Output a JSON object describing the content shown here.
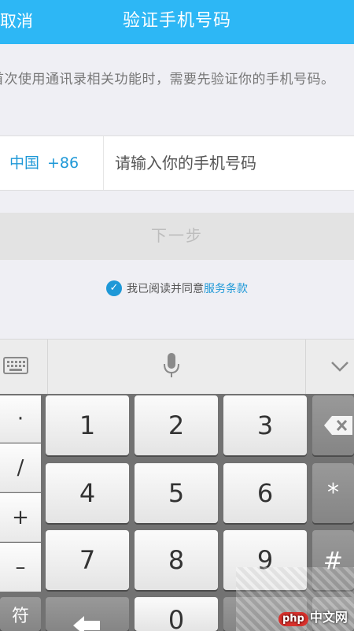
{
  "header": {
    "cancel_label": "取消",
    "title": "验证手机号码"
  },
  "description": "首次使用通讯录相关功能时，需要先验证你的手机号码。",
  "phone": {
    "country": "中国",
    "code": "+86",
    "placeholder": "请输入你的手机号码"
  },
  "next_label": "下一步",
  "agreement": {
    "text": "我已阅读并同意",
    "link": "服务条款"
  },
  "keyboard": {
    "symbols": [
      "·",
      "/",
      "+",
      "–",
      "符"
    ],
    "rows": [
      [
        "1",
        "2",
        "3"
      ],
      [
        "4",
        "5",
        "6"
      ],
      [
        "7",
        "8",
        "9"
      ],
      [
        "",
        "0",
        ""
      ]
    ],
    "right": [
      "⌫",
      "*",
      "#"
    ]
  },
  "watermark": {
    "php": "php",
    "text": "中文网"
  }
}
